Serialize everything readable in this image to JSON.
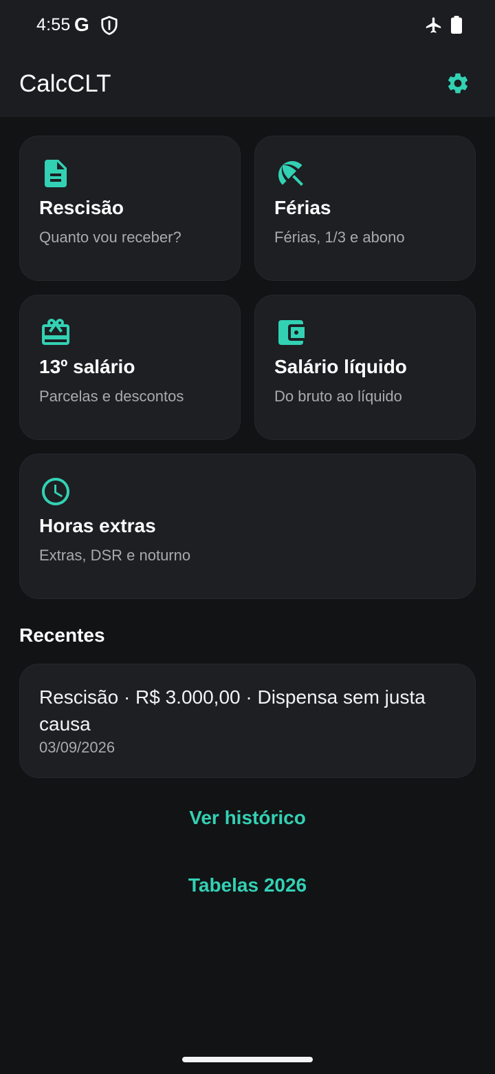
{
  "status_bar": {
    "time": "4:55",
    "google_letter": "G",
    "icons": [
      "shield-icon",
      "airplane-icon",
      "battery-icon"
    ]
  },
  "app_bar": {
    "title": "CalcCLT",
    "settings_icon": "gear-icon"
  },
  "colors": {
    "accent": "#33d1b4",
    "background": "#111315",
    "card": "#1d1f22",
    "muted_text": "#a7abb0"
  },
  "cards": [
    {
      "title": "Rescisão",
      "subtitle": "Quanto vou receber?",
      "icon": "document-icon"
    },
    {
      "title": "Férias",
      "subtitle": "Férias, 1/3 e abono",
      "icon": "beach-umbrella-icon"
    },
    {
      "title": "13º salário",
      "subtitle": "Parcelas e descontos",
      "icon": "gift-card-icon"
    },
    {
      "title": "Salário líquido",
      "subtitle": "Do bruto ao líquido",
      "icon": "wallet-icon"
    },
    {
      "title": "Horas extras",
      "subtitle": "Extras, DSR e noturno",
      "icon": "clock-icon"
    }
  ],
  "recents": {
    "title": "Recentes",
    "items": [
      {
        "text": "Rescisão · R$ 3.000,00 · Dispensa sem justa causa",
        "date": "03/09/2026"
      }
    ]
  },
  "links": {
    "history": "Ver histórico",
    "tables": "Tabelas 2026"
  }
}
